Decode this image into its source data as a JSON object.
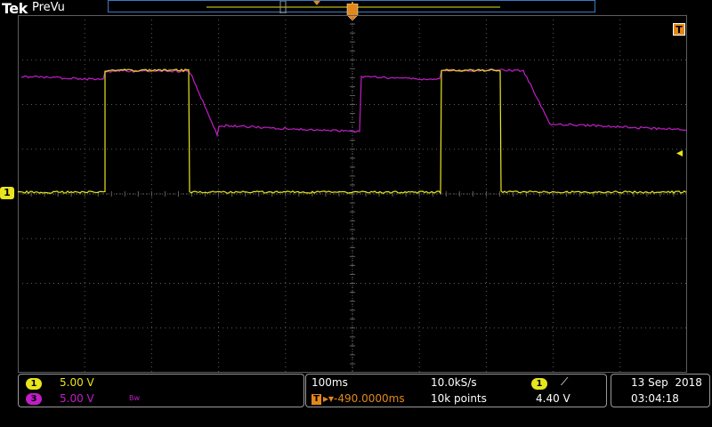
{
  "header": {
    "brand": "Tek",
    "acquisition_state": "PreVu",
    "trigger_position_marker": "T"
  },
  "markers": {
    "channel1": "1",
    "trigger_level": "◂"
  },
  "channels": {
    "ch1": {
      "number": "1",
      "scale": "5.00 V",
      "color": "#e8e51e"
    },
    "ch3": {
      "number": "3",
      "scale": "5.00 V",
      "suffix": "Bw",
      "color": "#c01ec6"
    }
  },
  "timebase": {
    "horizontal_scale": "100ms",
    "sample_rate": "10.0kS/s",
    "delay_icon": "T",
    "delay": "▸▾-490.0000ms",
    "record_length": "10k points"
  },
  "trigger": {
    "source": "1",
    "slope": "⟋",
    "level": "4.40 V"
  },
  "datetime": {
    "date": "13 Sep  2018",
    "time": "03:04:18"
  },
  "colors": {
    "grid": "#5e5e5e",
    "ch1": "#e8e51e",
    "ch3": "#c01ec6",
    "record_box": "#3b79c4",
    "trigger": "#e2881a"
  }
}
